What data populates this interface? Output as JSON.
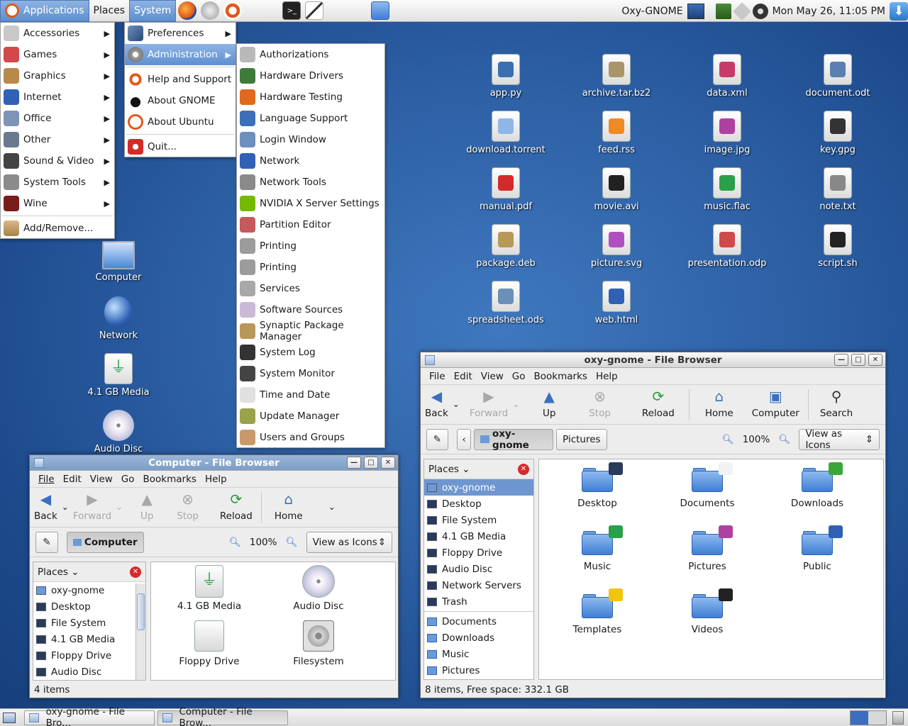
{
  "top_panel": {
    "applications": "Applications",
    "places": "Places",
    "system": "System",
    "username": "Oxy-GNOME",
    "clock": "Mon May 26, 11:05 PM"
  },
  "app_menu": {
    "items": [
      {
        "label": "Accessories",
        "icon": "accessories-icon",
        "color": "#c8c8c8"
      },
      {
        "label": "Games",
        "icon": "games-icon",
        "color": "#d34848"
      },
      {
        "label": "Graphics",
        "icon": "graphics-icon",
        "color": "#b88a4a"
      },
      {
        "label": "Internet",
        "icon": "internet-icon",
        "color": "#2f62b5"
      },
      {
        "label": "Office",
        "icon": "office-icon",
        "color": "#7d94b6"
      },
      {
        "label": "Other",
        "icon": "other-icon",
        "color": "#6a7a8e"
      },
      {
        "label": "Sound & Video",
        "icon": "sound-video-icon",
        "color": "#444"
      },
      {
        "label": "System Tools",
        "icon": "system-tools-icon",
        "color": "#8b8b8b"
      },
      {
        "label": "Wine",
        "icon": "wine-icon",
        "color": "#7a1c1c"
      }
    ],
    "add_remove": "Add/Remove..."
  },
  "system_menu": {
    "preferences": "Preferences",
    "administration": "Administration",
    "help": "Help and Support",
    "about_gnome": "About GNOME",
    "about_ubuntu": "About Ubuntu",
    "quit": "Quit..."
  },
  "admin_menu": {
    "items": [
      {
        "label": "Authorizations",
        "color": "#b9b9b9"
      },
      {
        "label": "Hardware Drivers",
        "color": "#3f7a3a"
      },
      {
        "label": "Hardware Testing",
        "color": "#e06a1c"
      },
      {
        "label": "Language Support",
        "color": "#3c6fb8"
      },
      {
        "label": "Login Window",
        "color": "#6d8fbd"
      },
      {
        "label": "Network",
        "color": "#2f62b5"
      },
      {
        "label": "Network Tools",
        "color": "#8a8a8a"
      },
      {
        "label": "NVIDIA X Server Settings",
        "color": "#76b900"
      },
      {
        "label": "Partition Editor",
        "color": "#c45a5a"
      },
      {
        "label": "Printing",
        "color": "#9c9c9c"
      },
      {
        "label": "Printing",
        "color": "#9c9c9c"
      },
      {
        "label": "Services",
        "color": "#a8a8a8"
      },
      {
        "label": "Software Sources",
        "color": "#c9b9d6"
      },
      {
        "label": "Synaptic Package Manager",
        "color": "#b89858"
      },
      {
        "label": "System Log",
        "color": "#333"
      },
      {
        "label": "System Monitor",
        "color": "#444"
      },
      {
        "label": "Time and Date",
        "color": "#e0e0e0"
      },
      {
        "label": "Update Manager",
        "color": "#9aa24a"
      },
      {
        "label": "Users and Groups",
        "color": "#c89a6a"
      }
    ]
  },
  "desktop_left": [
    {
      "label": "Computer",
      "icon": "computer-icon"
    },
    {
      "label": "Network",
      "icon": "network-icon"
    },
    {
      "label": "4.1 GB Media",
      "icon": "usb-media-icon"
    },
    {
      "label": "Audio Disc",
      "icon": "audio-disc-icon"
    }
  ],
  "desktop_files": [
    {
      "label": "app.py",
      "icon": "python-file-icon",
      "color": "#3a6fb0"
    },
    {
      "label": "archive.tar.bz2",
      "icon": "archive-icon",
      "color": "#a8956a"
    },
    {
      "label": "data.xml",
      "icon": "xml-file-icon",
      "color": "#c83a6a"
    },
    {
      "label": "document.odt",
      "icon": "document-icon",
      "color": "#5a7fb0"
    },
    {
      "label": "download.torrent",
      "icon": "torrent-icon",
      "color": "#8fb6e6"
    },
    {
      "label": "feed.rss",
      "icon": "rss-icon",
      "color": "#f08a24"
    },
    {
      "label": "image.jpg",
      "icon": "image-icon",
      "color": "#b040a0"
    },
    {
      "label": "key.gpg",
      "icon": "key-icon",
      "color": "#333333"
    },
    {
      "label": "manual.pdf",
      "icon": "pdf-icon",
      "color": "#d42a2a"
    },
    {
      "label": "movie.avi",
      "icon": "movie-icon",
      "color": "#222222"
    },
    {
      "label": "music.flac",
      "icon": "music-icon",
      "color": "#2aa04a"
    },
    {
      "label": "note.txt",
      "icon": "text-file-icon",
      "color": "#888888"
    },
    {
      "label": "package.deb",
      "icon": "deb-package-icon",
      "color": "#b89858"
    },
    {
      "label": "picture.svg",
      "icon": "svg-icon",
      "color": "#b050c0"
    },
    {
      "label": "presentation.odp",
      "icon": "presentation-icon",
      "color": "#d04a4a"
    },
    {
      "label": "script.sh",
      "icon": "terminal-icon",
      "color": "#222222"
    },
    {
      "label": "spreadsheet.ods",
      "icon": "spreadsheet-icon",
      "color": "#6a8fb8"
    },
    {
      "label": "web.html",
      "icon": "web-icon",
      "color": "#2f62b5"
    }
  ],
  "computer_window": {
    "title": "Computer - File Browser",
    "menubar": [
      "File",
      "Edit",
      "View",
      "Go",
      "Bookmarks",
      "Help"
    ],
    "toolbar": {
      "back": "Back",
      "forward": "Forward",
      "up": "Up",
      "stop": "Stop",
      "reload": "Reload",
      "home": "Home"
    },
    "location": "Computer",
    "zoom": "100%",
    "view_mode": "View as Icons",
    "places_label": "Places",
    "sidebar": [
      "oxy-gnome",
      "Desktop",
      "File System",
      "4.1 GB Media",
      "Floppy Drive",
      "Audio Disc"
    ],
    "items": [
      {
        "label": "4.1 GB Media",
        "icon": "usb-media-icon"
      },
      {
        "label": "Audio Disc",
        "icon": "audio-disc-icon"
      },
      {
        "label": "Floppy Drive",
        "icon": "floppy-icon"
      },
      {
        "label": "Filesystem",
        "icon": "harddisk-icon"
      }
    ],
    "status": "4 items"
  },
  "oxy_window": {
    "title": "oxy-gnome - File Browser",
    "menubar": [
      "File",
      "Edit",
      "View",
      "Go",
      "Bookmarks",
      "Help"
    ],
    "toolbar": {
      "back": "Back",
      "forward": "Forward",
      "up": "Up",
      "stop": "Stop",
      "reload": "Reload",
      "home": "Home",
      "computer": "Computer",
      "search": "Search"
    },
    "path": [
      "oxy-gnome",
      "Pictures"
    ],
    "zoom": "100%",
    "view_mode": "View as Icons",
    "places_label": "Places",
    "sidebar": [
      "oxy-gnome",
      "Desktop",
      "File System",
      "4.1 GB Media",
      "Floppy Drive",
      "Audio Disc",
      "Network Servers",
      "Trash"
    ],
    "bookmarks": [
      "Documents",
      "Downloads",
      "Music",
      "Pictures"
    ],
    "folders": [
      {
        "label": "Desktop",
        "emblem": "desktop-emblem-icon",
        "color": "#2a3a5a"
      },
      {
        "label": "Documents",
        "emblem": "documents-emblem-icon",
        "color": "#f2f2f2"
      },
      {
        "label": "Downloads",
        "emblem": "download-arrow-icon",
        "color": "#3aa63a"
      },
      {
        "label": "Music",
        "emblem": "music-note-icon",
        "color": "#2aa04a"
      },
      {
        "label": "Pictures",
        "emblem": "picture-emblem-icon",
        "color": "#b040a0"
      },
      {
        "label": "Public",
        "emblem": "globe-emblem-icon",
        "color": "#2f62b5"
      },
      {
        "label": "Templates",
        "emblem": "star-emblem-icon",
        "color": "#f2c40e"
      },
      {
        "label": "Videos",
        "emblem": "clapper-emblem-icon",
        "color": "#222222"
      }
    ],
    "status": "8 items, Free space: 332.1 GB"
  },
  "taskbar": [
    {
      "label": "oxy-gnome - File Bro..."
    },
    {
      "label": "Computer - File Brow..."
    }
  ],
  "colors": {
    "accent": "#5f8fd0",
    "desktop": "#2c5ea3"
  }
}
